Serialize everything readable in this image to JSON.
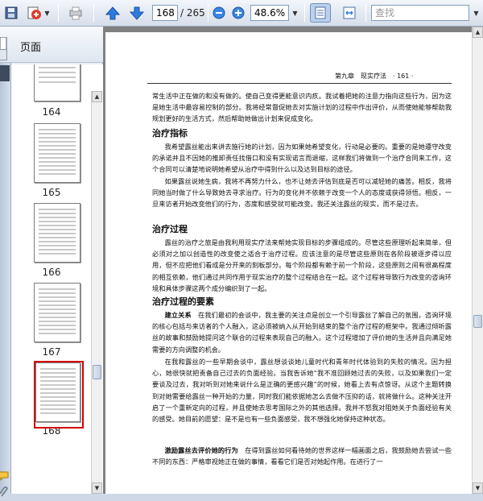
{
  "toolbar": {
    "current_page": "168",
    "total_pages": "/ 265",
    "zoom": "48.6%",
    "search_placeholder": "查找",
    "icons": [
      "save-icon",
      "share-icon",
      "print-icon",
      "prev-page-icon",
      "next-page-icon",
      "zoom-out-icon",
      "zoom-in-icon",
      "fit-page-icon",
      "fit-width-icon",
      "search-icon"
    ]
  },
  "sidebar": {
    "title": "页面",
    "options_icon": "gear-icon",
    "thumbnails": [
      {
        "label": "164"
      },
      {
        "label": "165"
      },
      {
        "label": "166"
      },
      {
        "label": "167"
      },
      {
        "label": "168",
        "selected": true
      }
    ]
  },
  "document": {
    "running_header": "第九章　现实疗法　· 161 ·",
    "paragraphs": {
      "p_intro": "常生活中正在做的和没有做的。使自己变得更能意识内疚。我试着把她的注意力指向这些行为，因为这是她生活中最容易控制的部分。我将经常督促她去对实施计划的过程中作出评价，从而使她能够帮助我规划更好的生活方式，然后帮助她做出计划来促成变化。",
      "h_plan": "治疗指标",
      "p_plan1": "我希望露丝能出来讲去施行她的计划，因为如果她希望变化，行动是必要的。重要的是她遵守改变的承诺并且不因她的推卸责任找借口和没有实现诺言而退缩，这样我们将做到一个治疗合同来工作，这个合同可以清楚地说明她希望从治疗中得到什么以及达到目标的途径。",
      "p_plan2": "如果露丝说她生病，我将不再努力什么，也不让她去评估到底是否可以减轻她的痛苦。相反，我将同她当时做了什么导致她去寻求治疗。行为的变化并不依赖于改变一个人的态度或获得领悟。相反，一旦来访者开始改变他们的行为，态度和感受就可能改变。我还关注露丝的现实，而不是过去。",
      "h_process": "治疗过程",
      "p_process": "露丝的治疗之旅是由我利用现实疗法来帮她实现目标的步骤组成的。尽管这些原理听起来简单，但必须对之加以创造性的改变使之适合于治疗过程。应该注意的是尽管这些原则在各阶段被逐步得以应用，但不应把他们看成是分开来的刻板部分。每个阶段都有赖于前一个阶段，这些原则之间有很高程度的相互依赖，他们通过共同作用于现实治疗的整个过程结合在一起。这个过程将导致行为改变的咨询环境和具体步骤这两个成分编织到了一起。",
      "h_elements": "治疗过程的要素",
      "p_elem1_lead": "建立关系",
      "p_elem1": "在我们最初的会谈中，我主要的关注点是创立一个引导露丝了解自己的氛围，咨询环境的核心包括与来访者的个人融入，这必须被纳入从开始到结束的整个治疗过程的框架中。我通过倾听露丝的故事和鼓励她提问这个联合的过程来表现自己的融入。这个过程增加了评价她的生活并且向满足她需要的方向调整的机会。",
      "p_elem2": "在我和露丝的一些早期会谈中，露丝想谈谈她儿童时代和青年时代体验到的失败的情况。因为担心，她很快就把责备自己过去的负面经验。当我告诉她“我不准回顾她过去的失败，以及如果我们一定要谈及过去，我对听到对她来说什么是正确的更感兴趣”的时候，她看上去有点惊讶。从这个主题转换到对她需要给露丝一种开始的力量，同时我们能依据她怎么去做不压抑的话，就将做什么。这种关注开启了一个重新定向的过程，并且使她去思考国际之外的其他选择。我并不怒我对阻她关于负面经验有关的感受。她目前的愿望：是不是也有一些负面感受，我不想强化她保持这种状态。",
      "p_elem3_lead": "激励露丝去评价她的行为",
      "p_elem3": "在得到露丝如何看待她的世界这样一幅画面之后，我鼓励她去尝试一些不同的东西：严格审视她正在做的事情，看看它们是否对她起作用。在进行了一"
    }
  }
}
